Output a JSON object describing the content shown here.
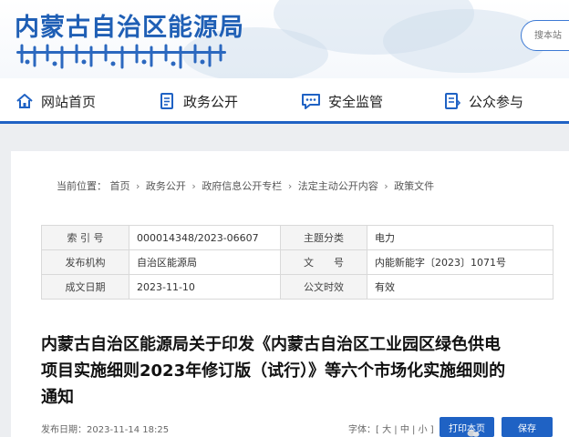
{
  "header": {
    "site_title": "内蒙古自治区能源局",
    "search_placeholder": "搜本站"
  },
  "nav": {
    "items": [
      {
        "label": "网站首页",
        "icon": "home-icon"
      },
      {
        "label": "政务公开",
        "icon": "document-icon"
      },
      {
        "label": "安全监管",
        "icon": "chat-shield-icon"
      },
      {
        "label": "公众参与",
        "icon": "clipboard-icon"
      }
    ]
  },
  "breadcrumb": {
    "prefix": "当前位置：",
    "items": [
      "首页",
      "政务公开",
      "政府信息公开专栏",
      "法定主动公开内容",
      "政策文件"
    ]
  },
  "meta": {
    "rows": [
      {
        "l1": "索 引 号",
        "v1": "000014348/2023-06607",
        "l2": "主题分类",
        "v2": "电力"
      },
      {
        "l1": "发布机构",
        "v1": "自治区能源局",
        "l2": "文　　号",
        "v2": "内能新能字〔2023〕1071号"
      },
      {
        "l1": "成文日期",
        "v1": "2023-11-10",
        "l2": "公文时效",
        "v2": "有效"
      }
    ]
  },
  "article": {
    "title": "内蒙古自治区能源局关于印发《内蒙古自治区工业园区绿色供电项目实施细则2023年修订版（试行）》等六个市场化实施细则的通知",
    "publish_label": "发布日期：",
    "publish_time": "2023-11-14 18:25",
    "font_label": "字体：",
    "font_open": "[",
    "font_large": "大",
    "font_medium": "中",
    "font_small": "小",
    "font_close": "]",
    "print_label": "打印本页",
    "save_label": "保存"
  },
  "colors": {
    "brand_blue": "#1f62c4",
    "title_blue": "#1f5fb5"
  }
}
